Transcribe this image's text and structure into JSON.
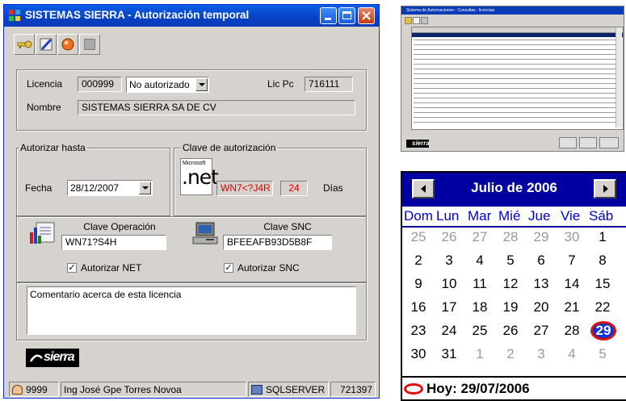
{
  "window": {
    "title": "SISTEMAS SIERRA - Autorización temporal"
  },
  "license": {
    "licencia_label": "Licencia",
    "licencia_value": "000999",
    "status_selected": "No autorizado",
    "licpc_label": "Lic Pc",
    "licpc_value": "716111",
    "nombre_label": "Nombre",
    "nombre_value": "SISTEMAS SIERRA SA DE CV"
  },
  "authorize": {
    "legend": "Autorizar hasta",
    "fecha_label": "Fecha",
    "fecha_value": "28/12/2007"
  },
  "clave": {
    "legend": "Clave de autorización",
    "net_logo_top": "Microsoft",
    "net_logo_text": ".net",
    "key_value": "WN7<?J4R",
    "days_value": "24",
    "days_label": "Días"
  },
  "operation": {
    "op_label": "Clave Operación",
    "op_value": "WN71?S4H",
    "snc_label": "Clave SNC",
    "snc_value": "BFEEAFB93D5B8F",
    "net_check_label": "Autorizar NET",
    "net_checked": true,
    "snc_check_label": "Autorizar SNC",
    "snc_checked": true
  },
  "comment": {
    "value": "Comentario acerca de esta licencia"
  },
  "logo": {
    "text": "sierra"
  },
  "statusbar": {
    "user_id": "9999",
    "user_name": "Ing José Gpe Torres Novoa",
    "server": "SQLSERVER",
    "code": "721397"
  },
  "list_window": {
    "title": "Sistema de Autorizaciones - Consultas - licencias"
  },
  "calendar": {
    "month_title": "Julio de 2006",
    "weekdays": [
      "Dom",
      "Lun",
      "Mar",
      "Mié",
      "Jue",
      "Vie",
      "Sáb"
    ],
    "weeks": [
      [
        "25",
        "26",
        "27",
        "28",
        "29",
        "30",
        "1"
      ],
      [
        "2",
        "3",
        "4",
        "5",
        "6",
        "7",
        "8"
      ],
      [
        "9",
        "10",
        "11",
        "12",
        "13",
        "14",
        "15"
      ],
      [
        "16",
        "17",
        "18",
        "19",
        "20",
        "21",
        "22"
      ],
      [
        "23",
        "24",
        "25",
        "26",
        "27",
        "28",
        "29"
      ],
      [
        "30",
        "31",
        "1",
        "2",
        "3",
        "4",
        "5"
      ]
    ],
    "today_text": "Hoy: 29/07/2006"
  },
  "colors": {
    "titlebar": "#0a4fd8",
    "calendar_header": "#0000a0",
    "key_red": "#e00000"
  }
}
